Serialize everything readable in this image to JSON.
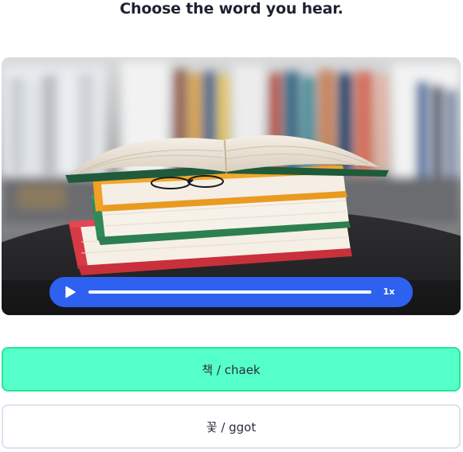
{
  "prompt": {
    "title": "Choose the word you hear."
  },
  "audio_player": {
    "speed_label": "1x",
    "play_icon": "play-icon",
    "progress": 0.0
  },
  "options": [
    {
      "label": "책 / chaek",
      "selected": true
    },
    {
      "label": "꽃 / ggot",
      "selected": false
    }
  ],
  "colors": {
    "player_blue": "#2e61f0",
    "selected_fill": "#55ffc9",
    "selected_border": "#2fe39a",
    "default_border": "#dde2ec",
    "title_text": "#1e2330"
  }
}
